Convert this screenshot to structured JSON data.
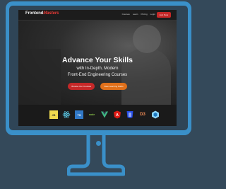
{
  "site": {
    "logo_main": "Frontend",
    "logo_accent": "Masters",
    "nav": [
      "Courses",
      "Learn",
      "Pricing",
      "Login"
    ],
    "join_label": "Join Now"
  },
  "hero": {
    "title": "Advance Your Skills",
    "subtitle_line1": "with In-Depth, Modern",
    "subtitle_line2": "Front-End Engineering Courses",
    "cta_primary": "Browse Our Courses",
    "cta_secondary": "View Learning Paths"
  },
  "tech_logos": [
    {
      "name": "javascript-icon",
      "label": "JS"
    },
    {
      "name": "react-icon",
      "label": ""
    },
    {
      "name": "typescript-icon",
      "label": "TS"
    },
    {
      "name": "nodejs-icon",
      "label": "node"
    },
    {
      "name": "vue-icon",
      "label": ""
    },
    {
      "name": "angular-icon",
      "label": "A"
    },
    {
      "name": "css3-icon",
      "label": ""
    },
    {
      "name": "d3-icon",
      "label": "D3"
    },
    {
      "name": "webpack-icon",
      "label": ""
    }
  ],
  "colors": {
    "background": "#34495a",
    "monitor": "#3a90c9",
    "brand_red": "#c62828",
    "brand_orange": "#e0701a"
  }
}
